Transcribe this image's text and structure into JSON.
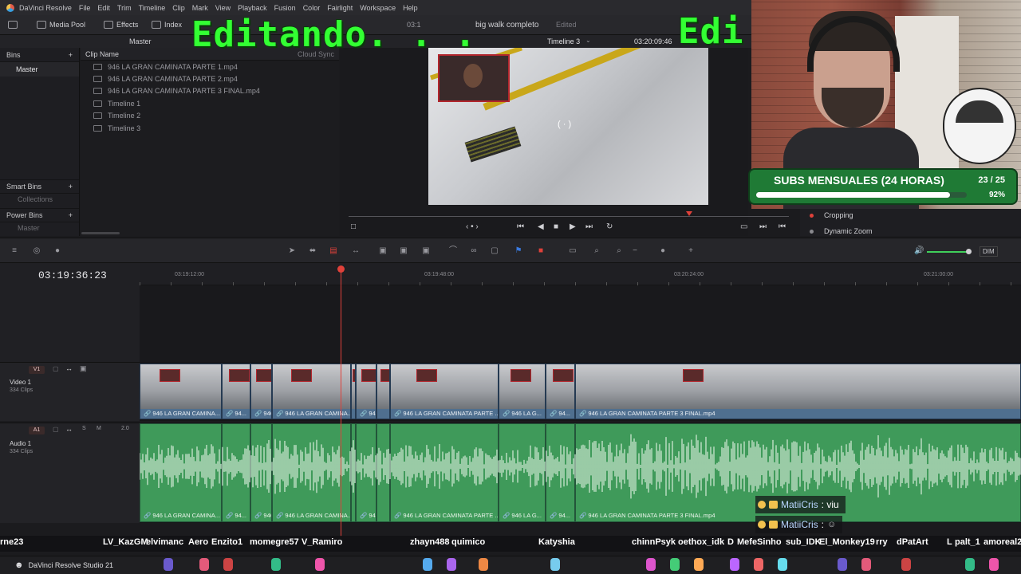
{
  "menu": {
    "app": "DaVinci Resolve",
    "items": [
      "File",
      "Edit",
      "Trim",
      "Timeline",
      "Clip",
      "Mark",
      "View",
      "Playback",
      "Fusion",
      "Color",
      "Fairlight",
      "Workspace",
      "Help"
    ]
  },
  "toolbar": {
    "media_pool": "Media Pool",
    "effects": "Effects",
    "index": "Index",
    "project_name": "big walk completo",
    "project_status": "Edited",
    "timecode_left": "03:1",
    "timeline_name": "Timeline 3",
    "timecode_right": "03:20:09:46"
  },
  "bins": {
    "header": "Bins",
    "master": "Master",
    "smart_bins": "Smart Bins",
    "collections": "Collections",
    "power_bins": "Power Bins",
    "power_master": "Master",
    "bar_master": "Master"
  },
  "clip_list": {
    "col_name": "Clip Name",
    "col_sync": "Cloud Sync",
    "items": [
      {
        "name": "946 LA GRAN CAMINATA PARTE 1.mp4",
        "kind": "clip"
      },
      {
        "name": "946 LA GRAN CAMINATA PARTE 2.mp4",
        "kind": "clip"
      },
      {
        "name": "946 LA GRAN CAMINATA PARTE 3 FINAL.mp4",
        "kind": "clip"
      },
      {
        "name": "Timeline 1",
        "kind": "timeline"
      },
      {
        "name": "Timeline 2",
        "kind": "timeline"
      },
      {
        "name": "Timeline 3",
        "kind": "timeline"
      }
    ]
  },
  "inspector": {
    "cropping": "Cropping",
    "dynamic_zoom": "Dynamic Zoom"
  },
  "timeline": {
    "timecode": "03:19:36:23",
    "dim": "DIM",
    "ruler": [
      "03:19:12:00",
      "03:19:48:00",
      "03:20:24:00",
      "03:21:00:00"
    ],
    "video_track": {
      "badge": "V1",
      "name": "Video 1",
      "clips": "334 Clips"
    },
    "audio_track": {
      "badge": "A1",
      "name": "Audio 1",
      "clips": "334 Clips",
      "level": "2.0"
    },
    "video_clip_labels": [
      "946 LA GRAN CAMINA...",
      "94...",
      "946 ...",
      "946 LA GRAN CAMINA...",
      "946...",
      "946 LA GRAN CAMINATA PARTE ...",
      "946 LA G...",
      "94...",
      "946 LA GRAN CAMINATA PARTE 3 FINAL.mp4"
    ],
    "audio_clip_labels": [
      "946 LA GRAN CAMINA...",
      "94...",
      "946 ...",
      "946 LA GRAN CAMINA...",
      "946...",
      "946 LA GRAN CAMINATA PARTE ...",
      "946 LA G...",
      "94...",
      "946 LA GRAN CAMINATA PARTE 3 FINAL.mp4"
    ]
  },
  "overlay": {
    "editing_text": "Editando. . .",
    "editing_text2": "Edi",
    "subs_title": "SUBS MENSUALES (24 HORAS)",
    "subs_count": "23 / 25",
    "subs_pct": "92%",
    "subs_progress": 0.92,
    "chat": [
      {
        "user": "MatiiCris",
        "msg": ": viu"
      },
      {
        "user": "MatiiCris",
        "msg": ":"
      }
    ],
    "names": [
      "rne23",
      "LV_KazGM",
      "elvimanc",
      "Aero",
      "Enzito1",
      "momegre57",
      "V_Ramiro",
      "zhayn488",
      "quimico",
      "Katyshia",
      "chinnPsyk",
      "oethox_idk",
      "D",
      "MefeSinho",
      "sub_IDK",
      "El_Monkey19",
      "rry",
      "dPatArt",
      "L",
      "palt_1",
      "amoreal2"
    ]
  },
  "taskbar": {
    "app_label": "DaVinci Resolve Studio 21"
  },
  "colors": {
    "video_clip": "#4f6f8f",
    "audio_clip": "#3f9a5a",
    "playhead": "#e0413a",
    "overlay_green": "#33ff33",
    "subs_green": "#1f7a35"
  }
}
